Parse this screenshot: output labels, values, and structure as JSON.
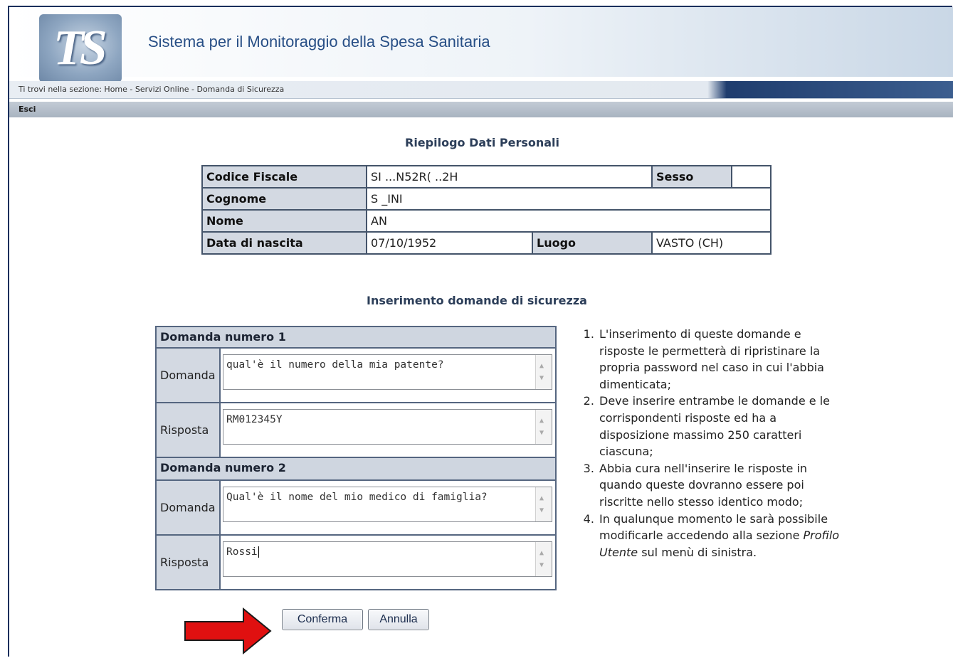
{
  "header": {
    "logo_text": "TS",
    "title": "Sistema per il Monitoraggio della Spesa Sanitaria"
  },
  "breadcrumb": {
    "prefix": "Ti trovi nella sezione:",
    "path": "Home - Servizi Online - Domanda di Sicurezza"
  },
  "menu": {
    "exit_label": "Esci"
  },
  "summary": {
    "title": "Riepilogo Dati Personali",
    "codice_fiscale_label": "Codice Fiscale",
    "codice_fiscale_value": "SI ...N52R( ..2H",
    "sesso_label": "Sesso",
    "sesso_value": "",
    "cognome_label": "Cognome",
    "cognome_value": "S _INI",
    "nome_label": "Nome",
    "nome_value": "AN",
    "data_nascita_label": "Data di nascita",
    "data_nascita_value": "07/10/1952",
    "luogo_label": "Luogo",
    "luogo_value": "VASTO (CH)"
  },
  "security": {
    "title": "Inserimento domande di sicurezza",
    "question1_header": "Domanda numero 1",
    "question2_header": "Domanda numero 2",
    "domanda_label": "Domanda",
    "risposta_label": "Risposta",
    "q1_domanda": "qual'è il numero della mia patente?",
    "q1_risposta": "RM012345Y",
    "q2_domanda": "Qual'è il nome del mio medico di famiglia?",
    "q2_risposta": "Rossi"
  },
  "notes": [
    "L'inserimento di queste domande e risposte le permetterà di ripristinare la propria password nel caso in cui l'abbia dimenticata;",
    "Deve inserire entrambe le domande e le corrispondenti risposte ed ha a disposizione massimo 250 caratteri ciascuna;",
    "Abbia cura nell'inserire le risposte in quando queste dovranno essere poi riscritte nello stesso identico modo;",
    "In qualunque momento le sarà possibile modificarle accedendo alla sezione",
    "Profilo Utente",
    "sul menù di sinistra."
  ],
  "buttons": {
    "confirm": "Conferma",
    "cancel": "Annulla"
  },
  "colors": {
    "header_blue": "#284f86",
    "label_bg": "#d3d9e2",
    "arrow_red": "#e01010"
  }
}
